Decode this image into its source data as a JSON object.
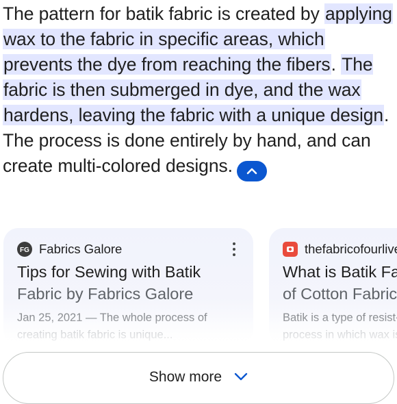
{
  "answer": {
    "part1": "The pattern for batik fabric is created by ",
    "highlight1": "applying wax to the fabric in specific areas, which prevents the dye from reaching the fibers",
    "part2": ". ",
    "highlight2": "The fabric is then submerged in dye, and the wax hardens, leaving the fabric with a unique design",
    "part3": ". The process is done entirely by hand, and can create multi-colored designs.",
    "collapse_icon": "chevron-up-icon"
  },
  "cards": [
    {
      "source": "Fabrics Galore",
      "favicon_text": "FG",
      "title_line1": "Tips for Sewing with Batik",
      "title_line2": "Fabric by Fabrics Galore",
      "snippet_line1": "Jan 25, 2021 — The whole process of",
      "snippet_line2": "creating batik fabric is unique...",
      "menu_icon": "more-vert-icon"
    },
    {
      "source": "thefabricofourlives.com",
      "favicon_text": "",
      "title_line1": "What is Batik Fabric?",
      "title_line2": "of Cotton Fabric",
      "snippet_line1": "Batik is a type of resist-dye",
      "snippet_line2": "process in which wax is...",
      "menu_icon": "more-vert-icon"
    }
  ],
  "show_more": {
    "label": "Show more",
    "icon": "chevron-down-icon"
  },
  "colors": {
    "accent": "#0b57d0",
    "highlight": "#e2e6ff",
    "text": "#1f1f1f",
    "muted": "#5f6368"
  }
}
